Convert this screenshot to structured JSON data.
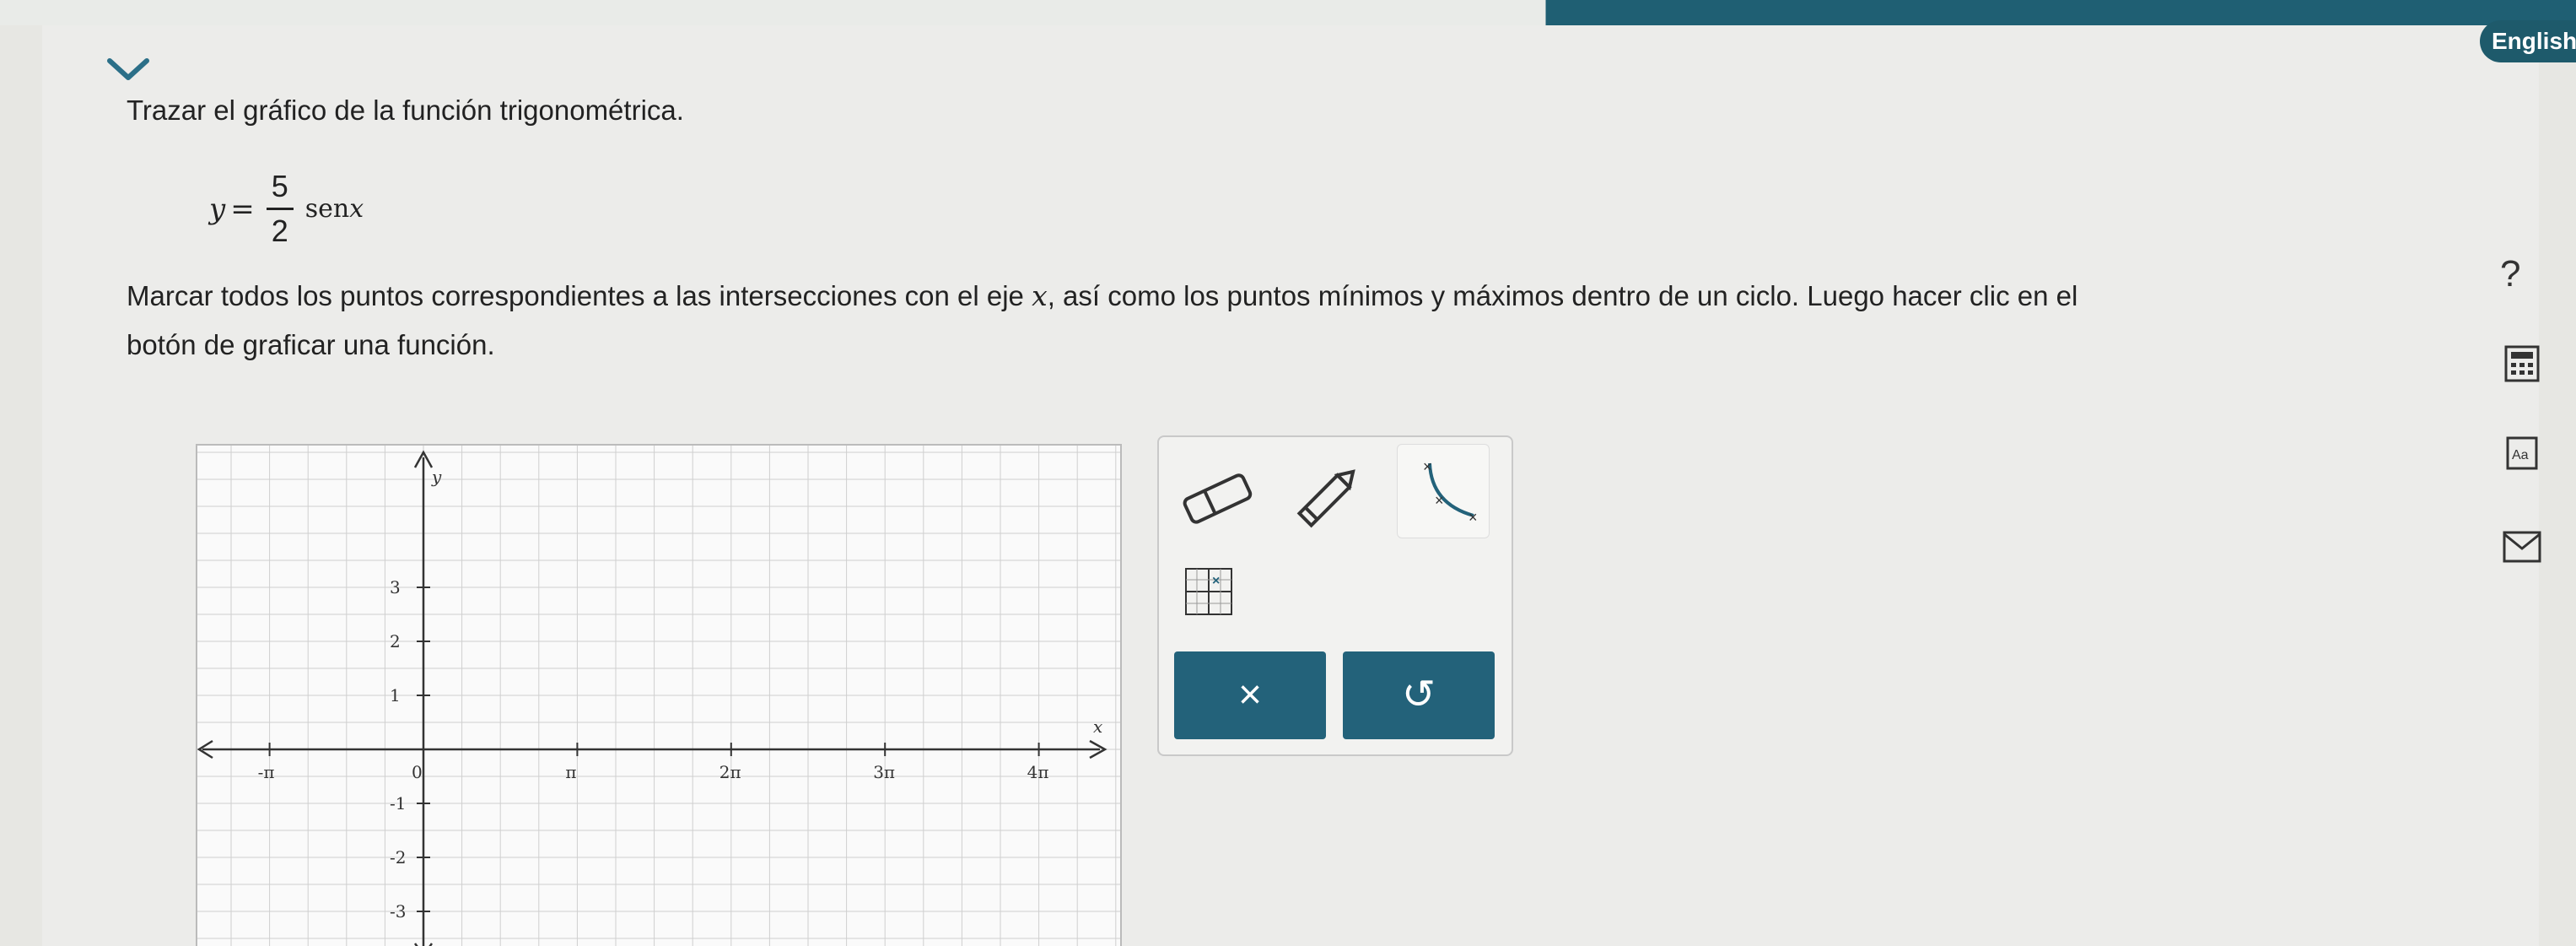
{
  "header": {
    "language_label": "English"
  },
  "problem": {
    "instruction": "Trazar el gráfico de la función trigonométrica.",
    "formula": {
      "lhs": "y",
      "equals": "=",
      "numerator": "5",
      "denominator": "2",
      "function": "sen",
      "variable": "x"
    },
    "task_part1": "Marcar todos los puntos correspondientes a las intersecciones con el eje ",
    "task_var": "x",
    "task_part2": ", así como los puntos mínimos y máximos dentro de un ciclo. Luego hacer clic en el",
    "task_line2": "botón de graficar una función."
  },
  "graph": {
    "y_axis_label": "y",
    "x_axis_label": "x",
    "x_ticks": [
      "-π",
      "0",
      "π",
      "2π",
      "3π",
      "4π"
    ],
    "y_ticks": [
      "3",
      "2",
      "1",
      "-1",
      "-2",
      "-3"
    ]
  },
  "tools": {
    "clear_label": "×",
    "undo_label": "↺"
  },
  "sidebar": {
    "help_label": "?"
  },
  "colors": {
    "accent": "#23627a",
    "accent_dark": "#1e5a6b",
    "grid": "#cfcfcf",
    "axis": "#333333"
  }
}
